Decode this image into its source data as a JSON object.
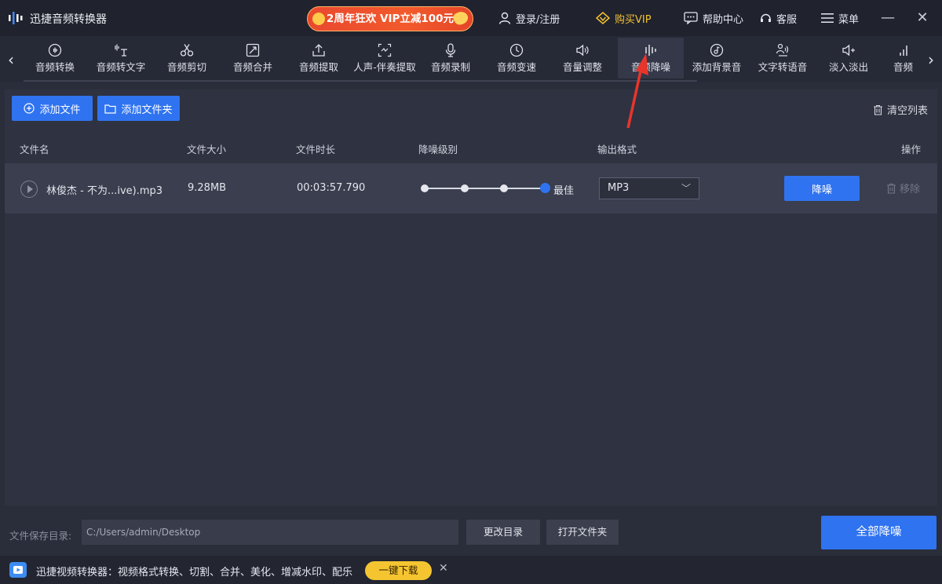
{
  "app": {
    "title": "迅捷音频转换器"
  },
  "promo": {
    "label": "2周年狂欢 VIP立减100元"
  },
  "titlebar": {
    "login": "登录/注册",
    "vip": "购买VIP",
    "help": "帮助中心",
    "service": "客服",
    "menu": "菜单"
  },
  "tabs": [
    {
      "label": "音频转换",
      "icon": "waveform-circle-icon"
    },
    {
      "label": "音频转文字",
      "icon": "voice-to-text-icon"
    },
    {
      "label": "音频剪切",
      "icon": "scissors-icon"
    },
    {
      "label": "音频合并",
      "icon": "merge-icon"
    },
    {
      "label": "音频提取",
      "icon": "extract-upload-icon"
    },
    {
      "label": "人声-伴奏提取",
      "icon": "vocal-separate-icon"
    },
    {
      "label": "音频录制",
      "icon": "microphone-icon"
    },
    {
      "label": "音频变速",
      "icon": "speed-clock-icon"
    },
    {
      "label": "音量调整",
      "icon": "speaker-icon"
    },
    {
      "label": "音频降噪",
      "icon": "noise-bars-icon",
      "active": true
    },
    {
      "label": "添加背景音",
      "icon": "music-disc-icon"
    },
    {
      "label": "文字转语音",
      "icon": "text-to-speech-icon"
    },
    {
      "label": "淡入淡出",
      "icon": "fade-icon"
    },
    {
      "label": "音频",
      "icon": "bars-icon"
    }
  ],
  "actions": {
    "add_file": "添加文件",
    "add_folder": "添加文件夹",
    "clear_list": "清空列表"
  },
  "table": {
    "headers": {
      "name": "文件名",
      "size": "文件大小",
      "duration": "文件时长",
      "level": "降噪级别",
      "format": "输出格式",
      "ops": "操作"
    },
    "rows": [
      {
        "name": "林俊杰 - 不为...ive).mp3",
        "size": "9.28MB",
        "duration": "00:03:57.790",
        "level_label": "最佳",
        "level_value": 4,
        "level_max": 4,
        "format": "MP3",
        "action": "降噪",
        "remove": "移除"
      }
    ]
  },
  "bottom": {
    "save_dir_label": "文件保存目录:",
    "save_dir_value": "C:/Users/admin/Desktop",
    "change_dir": "更改目录",
    "open_folder": "打开文件夹",
    "process_all": "全部降噪"
  },
  "ad": {
    "text": "迅捷视频转换器：视频格式转换、切割、合并、美化、增减水印、配乐",
    "button": "一键下载"
  },
  "colors": {
    "accent": "#2f73f0",
    "vip": "#f5c232",
    "promo": "#ee4f2c",
    "annotation_arrow": "#e8352c"
  }
}
